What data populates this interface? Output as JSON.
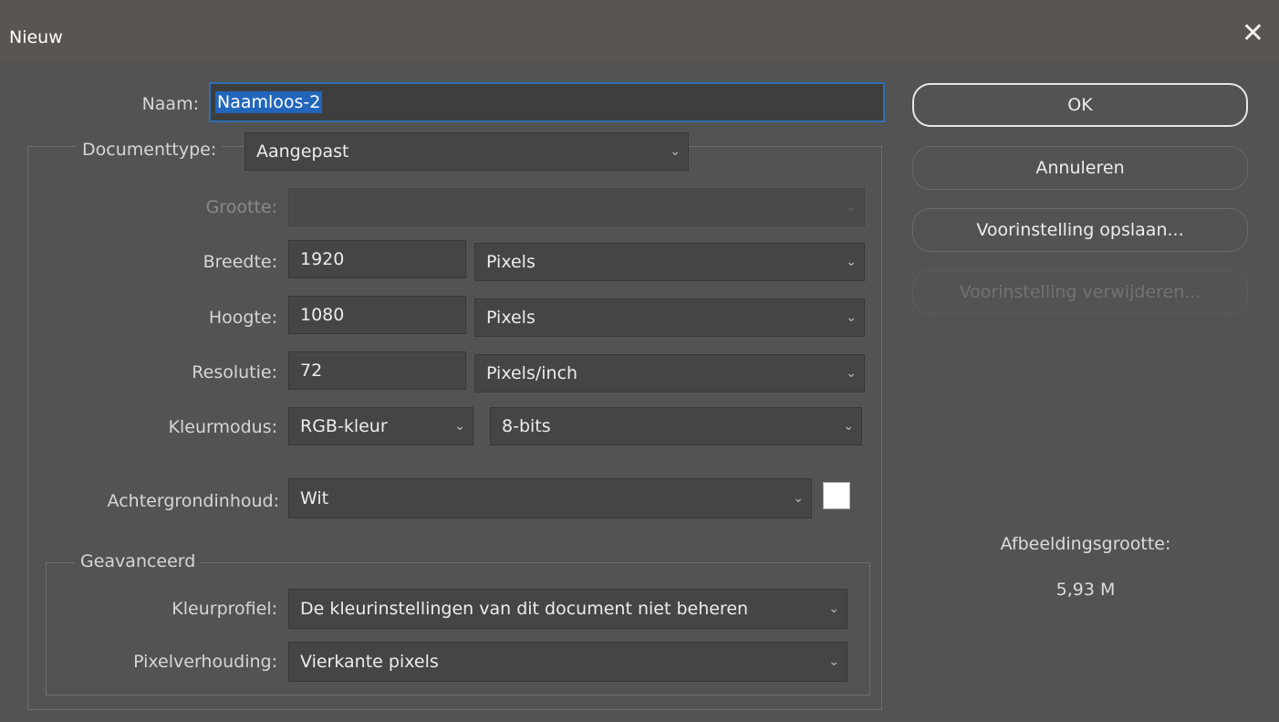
{
  "window": {
    "title": "Nieuw",
    "close_icon": "close-icon"
  },
  "name": {
    "label": "Naam:",
    "value": "Naamloos-2"
  },
  "document_type": {
    "label": "Documenttype:",
    "value": "Aangepast"
  },
  "size": {
    "label": "Grootte:",
    "value": ""
  },
  "width": {
    "label": "Breedte:",
    "value": "1920",
    "unit": "Pixels"
  },
  "height": {
    "label": "Hoogte:",
    "value": "1080",
    "unit": "Pixels"
  },
  "resolution": {
    "label": "Resolutie:",
    "value": "72",
    "unit": "Pixels/inch"
  },
  "color_mode": {
    "label": "Kleurmodus:",
    "mode": "RGB-kleur",
    "depth": "8-bits"
  },
  "background": {
    "label": "Achtergrondinhoud:",
    "value": "Wit",
    "swatch_color": "#ffffff"
  },
  "advanced": {
    "legend": "Geavanceerd",
    "color_profile": {
      "label": "Kleurprofiel:",
      "value": "De kleurinstellingen van dit document niet beheren"
    },
    "pixel_aspect": {
      "label": "Pixelverhouding:",
      "value": "Vierkante pixels"
    }
  },
  "buttons": {
    "ok": "OK",
    "cancel": "Annuleren",
    "save_preset": "Voorinstelling opslaan...",
    "delete_preset": "Voorinstelling verwijderen..."
  },
  "image_size": {
    "label": "Afbeeldingsgrootte:",
    "value": "5,93 M"
  },
  "colors": {
    "accent": "#2266bb",
    "background": "#535353",
    "titlebar": "#5a5550"
  }
}
